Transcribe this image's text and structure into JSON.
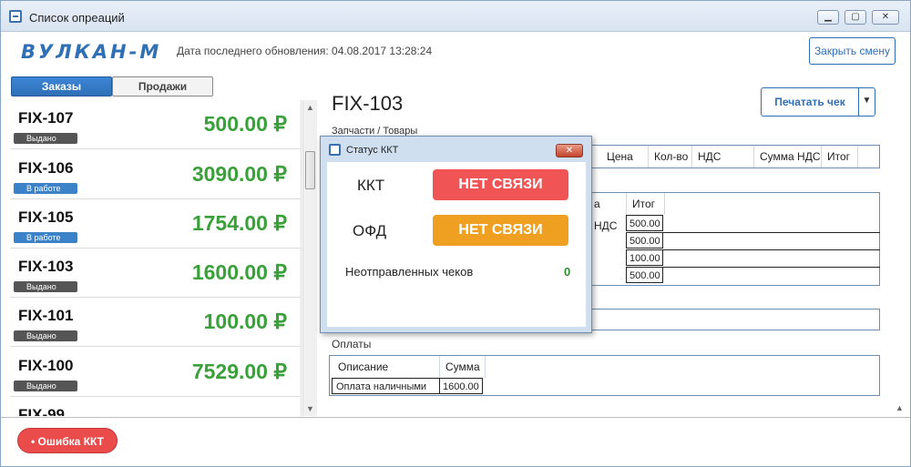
{
  "window": {
    "title": "Список опреаций"
  },
  "window_controls": {
    "minimize": "▁",
    "maximize": "▢",
    "close": "✕"
  },
  "header": {
    "logo": "ВУЛКАН-М",
    "last_update": "Дата последнего обновления: 04.08.2017 13:28:24",
    "close_shift": "Закрыть смену"
  },
  "tabs": {
    "orders": "Заказы",
    "sales": "Продажи"
  },
  "orders": [
    {
      "id": "FIX-107",
      "amount": "500.00 ₽",
      "status": "Выдано"
    },
    {
      "id": "FIX-106",
      "amount": "3090.00 ₽",
      "status": "В работе"
    },
    {
      "id": "FIX-105",
      "amount": "1754.00 ₽",
      "status": "В работе"
    },
    {
      "id": "FIX-103",
      "amount": "1600.00 ₽",
      "status": "Выдано"
    },
    {
      "id": "FIX-101",
      "amount": "100.00 ₽",
      "status": "Выдано"
    },
    {
      "id": "FIX-100",
      "amount": "7529.00 ₽",
      "status": "Выдано"
    },
    {
      "id": "FIX-99",
      "amount": "",
      "status": ""
    }
  ],
  "detail": {
    "title": "FIX-103",
    "print_button": "Печатать чек",
    "parts_label": "Запчасти / Товары",
    "parts_headers": [
      "Цена",
      "Кол-во",
      "НДС",
      "Сумма НДС",
      "Итог"
    ],
    "services_headers": [
      "а НДС",
      "Итог"
    ],
    "services_totals": [
      "500.00",
      "500.00",
      "100.00",
      "500.00"
    ],
    "payments_label": "Оплаты",
    "payments_headers": [
      "Описание",
      "Сумма"
    ],
    "payments_rows": [
      {
        "description": "Оплата наличными",
        "amount": "1600.00"
      }
    ]
  },
  "dialog": {
    "title": "Статус ККТ",
    "close": "✕",
    "kkt_label": "ККТ",
    "kkt_status": "НЕТ СВЯЗИ",
    "ofd_label": "ОФД",
    "ofd_status": "НЕТ СВЯЗИ",
    "unsent_label": "Неотправленных чеков",
    "unsent_count": "0"
  },
  "status_bar": {
    "kkt_error": "• Ошибка ККТ"
  },
  "icons": {
    "scroll_up": "▲",
    "scroll_down": "▼",
    "dropdown": "▼"
  },
  "colors": {
    "accent": "#2f6fb6",
    "amount_green": "#3aa03a",
    "error_red": "#ea4b4b",
    "warning_orange": "#f0a020"
  }
}
